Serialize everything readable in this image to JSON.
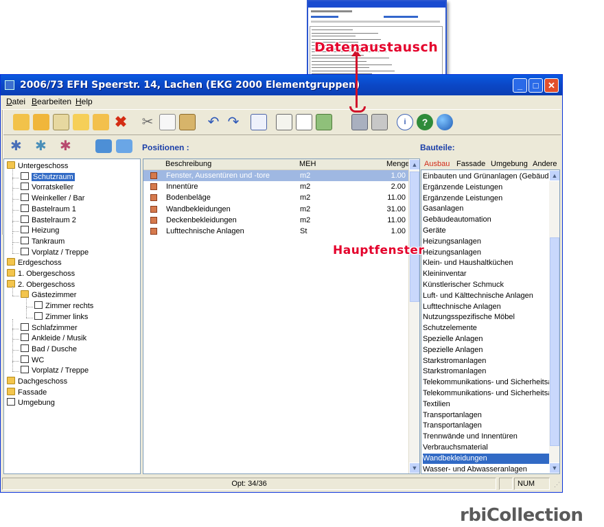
{
  "window": {
    "title": "2006/73 EFH Speerstr. 14, Lachen (EKG 2000 Elementgruppen)"
  },
  "menu": [
    {
      "label": "Datei",
      "underline": "D"
    },
    {
      "label": "Bearbeiten",
      "underline": "B"
    },
    {
      "label": "Help",
      "underline": "H"
    }
  ],
  "tree": [
    {
      "label": "Untergeschoss",
      "icon": "folder-open-icon",
      "level": 0,
      "selected": false
    },
    {
      "label": "Schutzraum",
      "icon": "document-icon",
      "level": 1,
      "selected": true
    },
    {
      "label": "Vorratskeller",
      "icon": "document-icon",
      "level": 1,
      "selected": false
    },
    {
      "label": "Weinkeller / Bar",
      "icon": "document-icon",
      "level": 1,
      "selected": false
    },
    {
      "label": "Bastelraum 1",
      "icon": "document-icon",
      "level": 1,
      "selected": false
    },
    {
      "label": "Bastelraum 2",
      "icon": "document-icon",
      "level": 1,
      "selected": false
    },
    {
      "label": "Heizung",
      "icon": "document-icon",
      "level": 1,
      "selected": false
    },
    {
      "label": "Tankraum",
      "icon": "document-icon",
      "level": 1,
      "selected": false
    },
    {
      "label": "Vorplatz / Treppe",
      "icon": "document-icon",
      "level": 1,
      "selected": false
    },
    {
      "label": "Erdgeschoss",
      "icon": "folder-icon",
      "level": 0,
      "selected": false
    },
    {
      "label": "1. Obergeschoss",
      "icon": "folder-icon",
      "level": 0,
      "selected": false
    },
    {
      "label": "2. Obergeschoss",
      "icon": "folder-open-icon",
      "level": 0,
      "selected": false
    },
    {
      "label": "Gästezimmer",
      "icon": "folder-open-icon",
      "level": 1,
      "selected": false
    },
    {
      "label": "Zimmer rechts",
      "icon": "document-icon",
      "level": 2,
      "selected": false
    },
    {
      "label": "Zimmer links",
      "icon": "document-icon",
      "level": 2,
      "selected": false
    },
    {
      "label": "Schlafzimmer",
      "icon": "document-icon",
      "level": 1,
      "selected": false
    },
    {
      "label": "Ankleide / Musik",
      "icon": "document-icon",
      "level": 1,
      "selected": false
    },
    {
      "label": "Bad / Dusche",
      "icon": "document-icon",
      "level": 1,
      "selected": false
    },
    {
      "label": "WC",
      "icon": "document-icon",
      "level": 1,
      "selected": false
    },
    {
      "label": "Vorplatz / Treppe",
      "icon": "document-icon",
      "level": 1,
      "selected": false
    },
    {
      "label": "Dachgeschoss",
      "icon": "folder-icon",
      "level": 0,
      "selected": false
    },
    {
      "label": "Fassade",
      "icon": "folder-icon",
      "level": 0,
      "selected": false
    },
    {
      "label": "Umgebung",
      "icon": "document-icon",
      "level": 0,
      "selected": false
    }
  ],
  "positions": {
    "label": "Positionen :",
    "columns": {
      "beschreibung": "Beschreibung",
      "meh": "MEH",
      "menge": "Menge"
    },
    "rows": [
      {
        "beschreibung": "Fenster, Aussentüren und -tore",
        "meh": "m2",
        "menge": "1.00",
        "selected": true
      },
      {
        "beschreibung": "Innentüre",
        "meh": "m2",
        "menge": "2.00",
        "selected": false
      },
      {
        "beschreibung": "Bodenbeläge",
        "meh": "m2",
        "menge": "11.00",
        "selected": false
      },
      {
        "beschreibung": "Wandbekleidungen",
        "meh": "m2",
        "menge": "31.00",
        "selected": false
      },
      {
        "beschreibung": "Deckenbekleidungen",
        "meh": "m2",
        "menge": "11.00",
        "selected": false
      },
      {
        "beschreibung": "Lufttechnische Anlagen",
        "meh": "St",
        "menge": "1.00",
        "selected": false
      }
    ]
  },
  "bauteile": {
    "label": "Bauteile:",
    "tabs": [
      "Ausbau",
      "Fassade",
      "Umgebung",
      "Andere"
    ],
    "active_tab": "Ausbau",
    "items": [
      "Einbauten und Grünanlagen (Gebäude",
      "Ergänzende Leistungen",
      "Ergänzende Leistungen",
      "Gasanlagen",
      "Gebäudeautomation",
      "Geräte",
      "Heizungsanlagen",
      "Heizungsanlagen",
      "Klein- und Haushaltküchen",
      "Kleininventar",
      "Künstlerischer Schmuck",
      "Luft- und Kälttechnische Anlagen",
      "Lufttechnische Anlagen",
      "Nutzungsspezifische Möbel",
      "Schutzelemente",
      "Spezielle Anlagen",
      "Spezielle Anlagen",
      "Starkstromanlagen",
      "Starkstromanlagen",
      "Telekommunikations- und Sicherheitsa",
      "Telekommunikations- und Sicherheitsa",
      "Textilien",
      "Transportanlagen",
      "Transportanlagen",
      "Trennwände und Innentüren",
      "Verbrauchsmaterial",
      "Wandbekleidungen",
      "Wasser- und Abwasseranlagen"
    ],
    "selected_index": 26
  },
  "status": {
    "opt": "Opt: 34/36",
    "num": "NUM"
  },
  "annotations": {
    "datenaustausch": "Datenaustausch",
    "hauptfenster": "Hauptfenster"
  },
  "watermark": "rbiCollection",
  "colors": {
    "titlebar": "#0b47c6",
    "selection": "#316ac5",
    "annotation": "#e4002b",
    "section_label": "#1a3ea8"
  }
}
